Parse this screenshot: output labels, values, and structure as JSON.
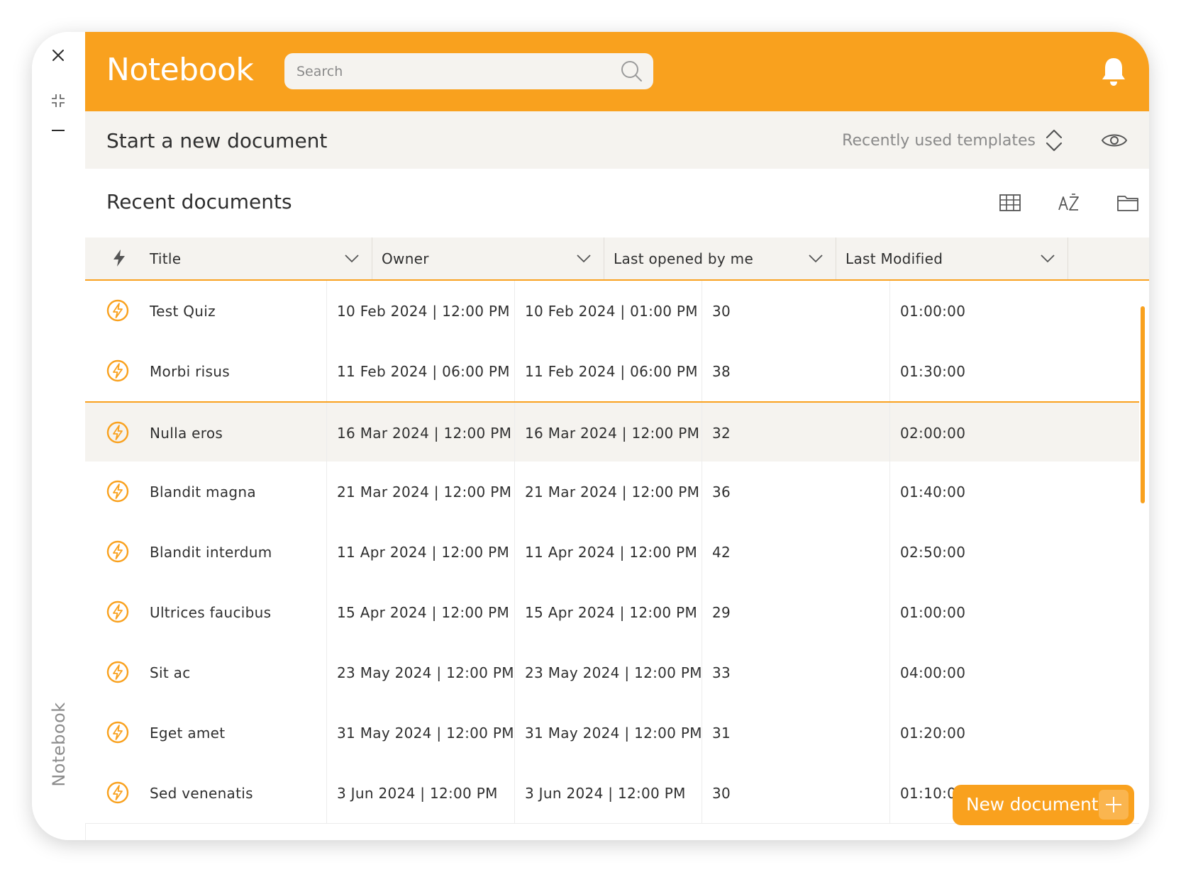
{
  "rail": {
    "vertical_label": "Notebook"
  },
  "header": {
    "title": "Notebook",
    "search_placeholder": "Search"
  },
  "new_document_bar": {
    "title": "Start a new document",
    "templates_label": "Recently used templates"
  },
  "recent": {
    "title": "Recent documents"
  },
  "table": {
    "columns": [
      "Title",
      "Owner",
      "Last opened by me",
      "Last Modified"
    ],
    "rows": [
      {
        "title": "Test Quiz",
        "owner": "10 Feb 2024 | 12:00 PM",
        "opened": "10 Feb 2024 | 01:00 PM",
        "count": "30",
        "modified": "01:00:00"
      },
      {
        "title": "Morbi risus",
        "owner": "11 Feb 2024 | 06:00 PM",
        "opened": "11 Feb 2024 | 06:00 PM",
        "count": "38",
        "modified": "01:30:00"
      },
      {
        "title": "Nulla eros",
        "owner": "16 Mar 2024 | 12:00 PM",
        "opened": "16 Mar 2024 | 12:00 PM",
        "count": "32",
        "modified": "02:00:00",
        "selected": true
      },
      {
        "title": "Blandit magna",
        "owner": "21 Mar 2024 | 12:00 PM",
        "opened": "21 Mar 2024 | 12:00 PM",
        "count": "36",
        "modified": "01:40:00"
      },
      {
        "title": "Blandit interdum",
        "owner": "11 Apr 2024 | 12:00 PM",
        "opened": "11 Apr 2024 | 12:00 PM",
        "count": "42",
        "modified": "02:50:00"
      },
      {
        "title": "Ultrices faucibus",
        "owner": "15 Apr 2024 | 12:00 PM",
        "opened": "15 Apr 2024 | 12:00 PM",
        "count": "29",
        "modified": "01:00:00"
      },
      {
        "title": "Sit ac",
        "owner": "23 May 2024 | 12:00 PM",
        "opened": "23 May 2024 | 12:00 PM",
        "count": "33",
        "modified": "04:00:00"
      },
      {
        "title": "Eget amet",
        "owner": "31 May 2024 | 12:00 PM",
        "opened": "31 May 2024 | 12:00 PM",
        "count": "31",
        "modified": "01:20:00"
      },
      {
        "title": "Sed venenatis",
        "owner": "3 Jun 2024 | 12:00 PM",
        "opened": "3 Jun 2024 | 12:00 PM",
        "count": "30",
        "modified": "01:10:00"
      }
    ]
  },
  "fab": {
    "label": "New document"
  },
  "colors": {
    "accent": "#f9a11e",
    "panel": "#f5f3ef",
    "text": "#2f2f2f",
    "muted": "#8a8a8a"
  }
}
